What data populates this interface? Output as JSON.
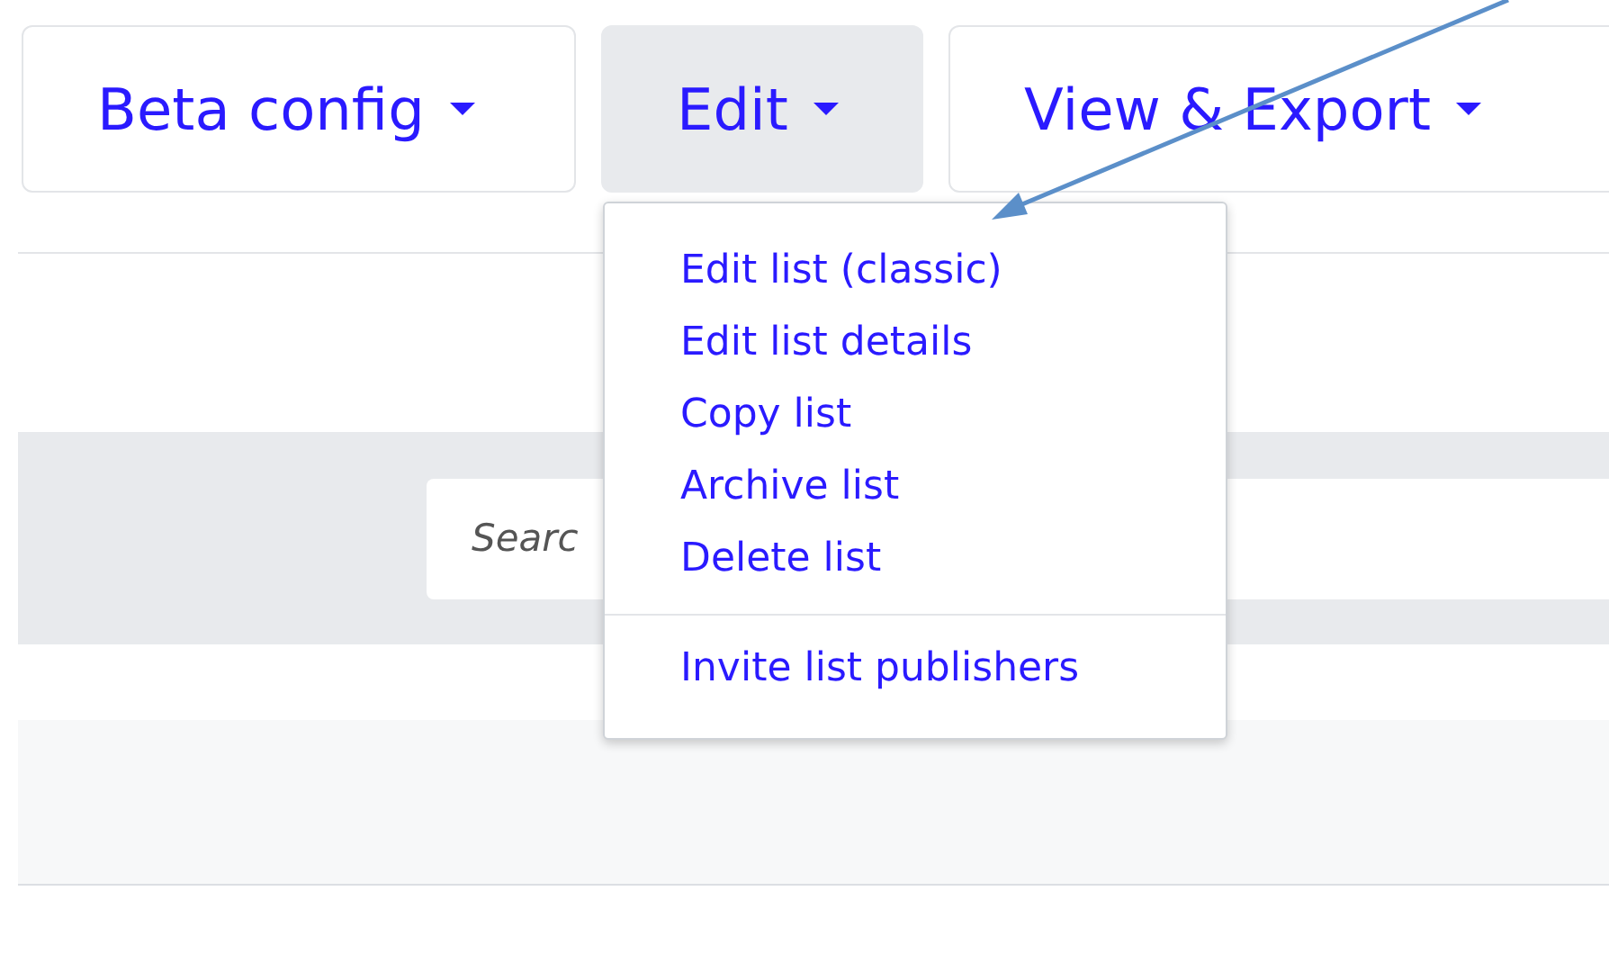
{
  "toolbar": [
    {
      "label": "Beta config",
      "expanded": false
    },
    {
      "label": "Edit",
      "expanded": true
    },
    {
      "label": "View & Export",
      "expanded": false
    }
  ],
  "menu": {
    "groups": [
      [
        "Edit list (classic)",
        "Edit list details",
        "Copy list",
        "Archive list",
        "Delete list"
      ],
      [
        "Invite list publishers"
      ]
    ]
  },
  "search": {
    "placeholder": "Searc"
  }
}
